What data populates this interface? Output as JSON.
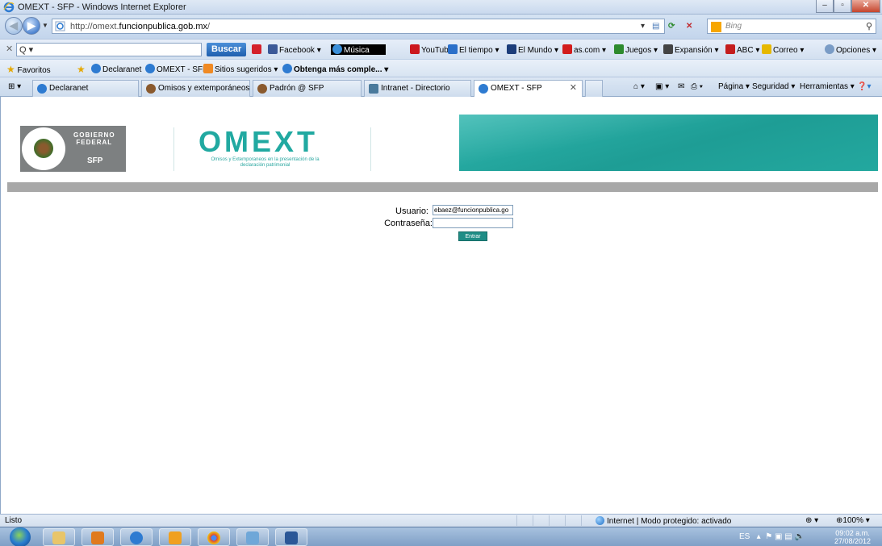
{
  "window": {
    "title": "OMEXT - SFP - Windows Internet Explorer",
    "buttons": [
      "–",
      "▫",
      "✕"
    ]
  },
  "address_bar": {
    "url_prefix": "http://omext.",
    "url_domain": "funcionpublica.gob.mx",
    "url_suffix": "/",
    "search_placeholder": "Bing"
  },
  "toolbar": {
    "search_value": "Q ▾",
    "buscar": "Buscar",
    "items": [
      {
        "label": "Facebook ▾",
        "color": "#3b5998"
      },
      {
        "label": "Música",
        "color": "#000000"
      },
      {
        "label": "YouTube",
        "color": "#cc181e"
      },
      {
        "label": "El tiempo ▾",
        "color": "#2a6fc9"
      },
      {
        "label": "El Mundo ▾",
        "color": "#1c3d7a"
      },
      {
        "label": "as.com ▾",
        "color": "#d21c1c"
      },
      {
        "label": "Juegos ▾",
        "color": "#2d8a2d"
      },
      {
        "label": "Expansión ▾",
        "color": "#444444"
      },
      {
        "label": "ABC ▾",
        "color": "#c41d1d"
      },
      {
        "label": "Correo ▾",
        "color": "#e6b800"
      }
    ],
    "options": "Opciones ▾"
  },
  "favorites": {
    "label": "Favoritos",
    "items": [
      "Declaranet",
      "OMEXT - SFP",
      "Sitios sugeridos ▾",
      "Obtenga más comple... ▾"
    ]
  },
  "tabs": [
    {
      "label": "Declaranet"
    },
    {
      "label": "Omisos y extemporáneos ..."
    },
    {
      "label": "Padrón @ SFP"
    },
    {
      "label": "Intranet - Directorio"
    },
    {
      "label": "OMEXT - SFP",
      "active": true
    }
  ],
  "command_bar": [
    "Página ▾",
    "Seguridad ▾",
    "Herramientas ▾"
  ],
  "page": {
    "seal_text_1": "GOBIERNO",
    "seal_text_2": "FEDERAL",
    "seal_text_3": "SFP",
    "logo": "OMEXT",
    "logo_sub": "Omisos y Extemporaneos en la presentación de la declaración patrimonial",
    "accent_color": "#21a9a1",
    "login": {
      "user_label": "Usuario:",
      "user_value": "ebaez@funcionpublica.go",
      "password_label": "Contraseña:",
      "password_value": "",
      "submit": "Entrar"
    }
  },
  "status_bar": {
    "text": "Listo",
    "zone": "Internet | Modo protegido: activado",
    "zoom": "100%"
  },
  "taskbar": {
    "lang": "ES",
    "time": "09:02 a.m.",
    "date": "27/08/2012"
  }
}
